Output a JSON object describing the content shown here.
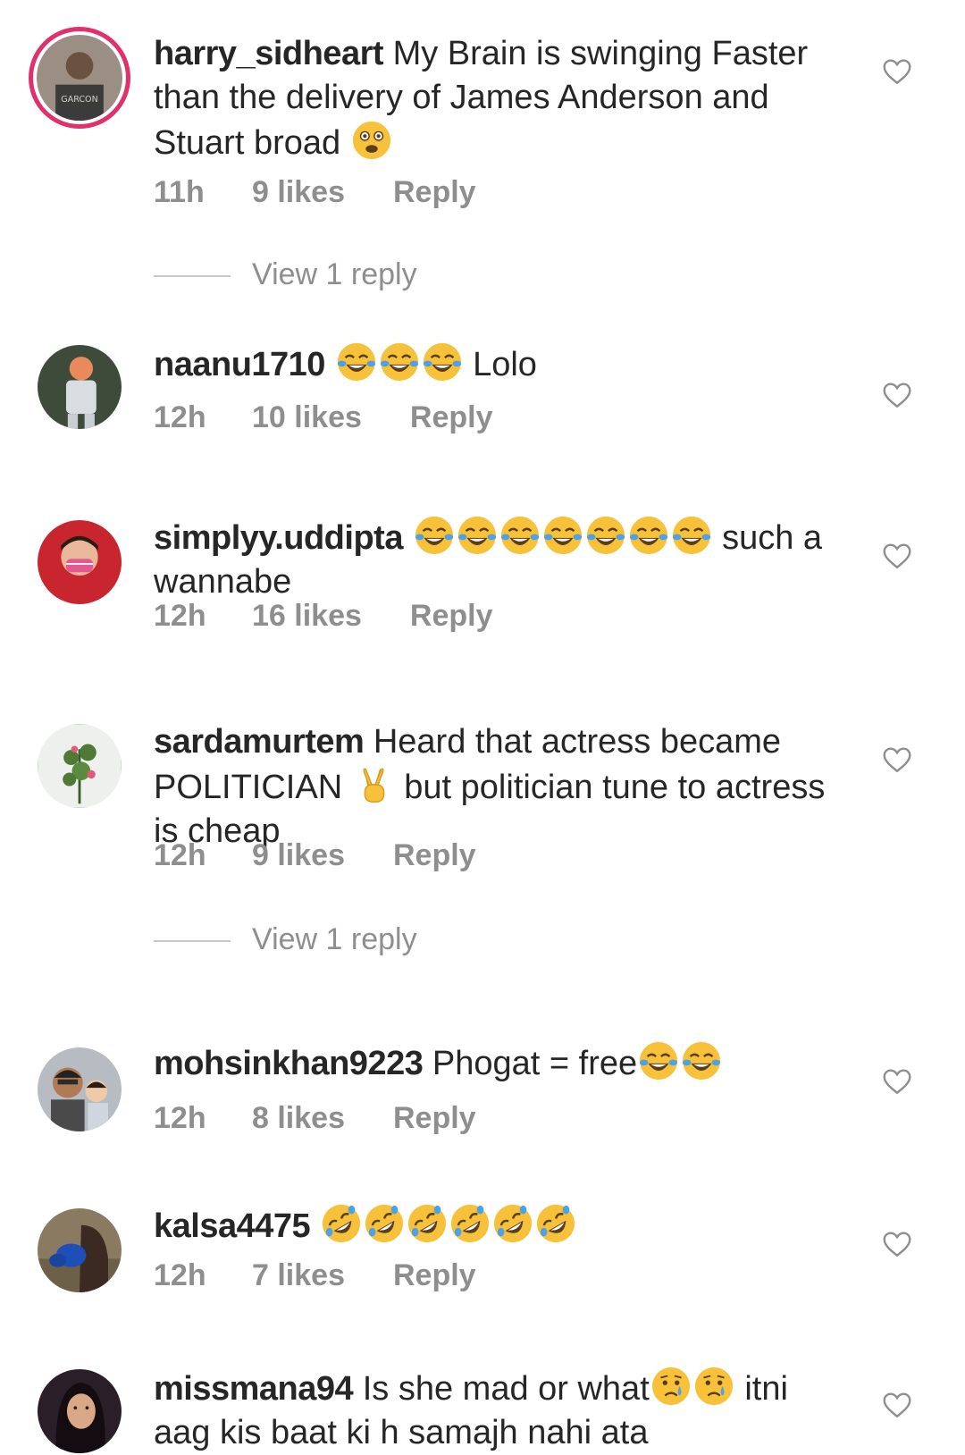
{
  "comments": [
    {
      "username": "harry_sidheart",
      "text": "My Brain is swinging Faster than the delivery of James Anderson and Stuart broad",
      "emojis": [
        "flushed-face-emoji"
      ],
      "time": "11h",
      "likes": "9 likes",
      "reply": "Reply",
      "view_replies": "View 1 reply"
    },
    {
      "username": "naanu1710",
      "text_prefix": "",
      "emojis": [
        "joy-emoji",
        "joy-emoji",
        "joy-emoji"
      ],
      "text": "Lolo",
      "time": "12h",
      "likes": "10 likes",
      "reply": "Reply"
    },
    {
      "username": "simplyy.uddipta",
      "emojis": [
        "joy-emoji",
        "joy-emoji",
        "joy-emoji",
        "joy-emoji",
        "joy-emoji",
        "joy-emoji",
        "joy-emoji"
      ],
      "text": "such a wannabe",
      "time": "12h",
      "likes": "16 likes",
      "reply": "Reply"
    },
    {
      "username": "sardamurtem",
      "text_before": "Heard that actress became POLITICIAN",
      "emojis": [
        "victory-hand-emoji"
      ],
      "text_after": "but politician tune to actress is cheap",
      "time": "12h",
      "likes": "9 likes",
      "reply": "Reply",
      "view_replies": "View 1 reply"
    },
    {
      "username": "mohsinkhan9223",
      "text": "Phogat = free",
      "emojis": [
        "joy-emoji",
        "joy-emoji"
      ],
      "time": "12h",
      "likes": "8 likes",
      "reply": "Reply"
    },
    {
      "username": "kalsa4475",
      "emojis": [
        "rofl-emoji",
        "rofl-emoji",
        "rofl-emoji",
        "rofl-emoji",
        "rofl-emoji",
        "rofl-emoji"
      ],
      "time": "12h",
      "likes": "7 likes",
      "reply": "Reply"
    },
    {
      "username": "missmana94",
      "text_before": "Is she mad or what",
      "emojis": [
        "crying-face-emoji",
        "crying-face-emoji"
      ],
      "text_after": "itni aag kis baat ki h samajh nahi ata"
    }
  ],
  "colors": {
    "text": "#262626",
    "meta": "#8e8e8e",
    "story_ring": "#e1306c"
  }
}
